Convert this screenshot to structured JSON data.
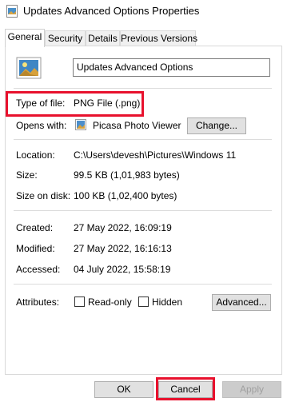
{
  "window": {
    "title": "Updates Advanced Options Properties",
    "title_icon": "image-file-icon"
  },
  "tabs": [
    {
      "label": "General",
      "active": true
    },
    {
      "label": "Security",
      "active": false
    },
    {
      "label": "Details",
      "active": false
    },
    {
      "label": "Previous Versions",
      "active": false
    }
  ],
  "general": {
    "file_name": "Updates Advanced Options",
    "type_of_file_label": "Type of file:",
    "type_of_file_value": "PNG File (.png)",
    "opens_with_label": "Opens with:",
    "opens_with_value": "Picasa Photo Viewer",
    "change_button": "Change...",
    "location_label": "Location:",
    "location_value": "C:\\Users\\devesh\\Pictures\\Windows 11",
    "size_label": "Size:",
    "size_value": "99.5 KB (1,01,983 bytes)",
    "size_on_disk_label": "Size on disk:",
    "size_on_disk_value": "100 KB (1,02,400 bytes)",
    "created_label": "Created:",
    "created_value": "27 May 2022, 16:09:19",
    "modified_label": "Modified:",
    "modified_value": "27 May 2022, 16:16:13",
    "accessed_label": "Accessed:",
    "accessed_value": "04 July 2022, 15:58:19",
    "attributes_label": "Attributes:",
    "readonly_label": "Read-only",
    "hidden_label": "Hidden",
    "advanced_button": "Advanced..."
  },
  "footer": {
    "ok": "OK",
    "cancel": "Cancel",
    "apply": "Apply"
  },
  "colors": {
    "highlight": "#e8112d",
    "tab_bg": "#f0f0f0",
    "button_bg": "#e1e1e1"
  }
}
